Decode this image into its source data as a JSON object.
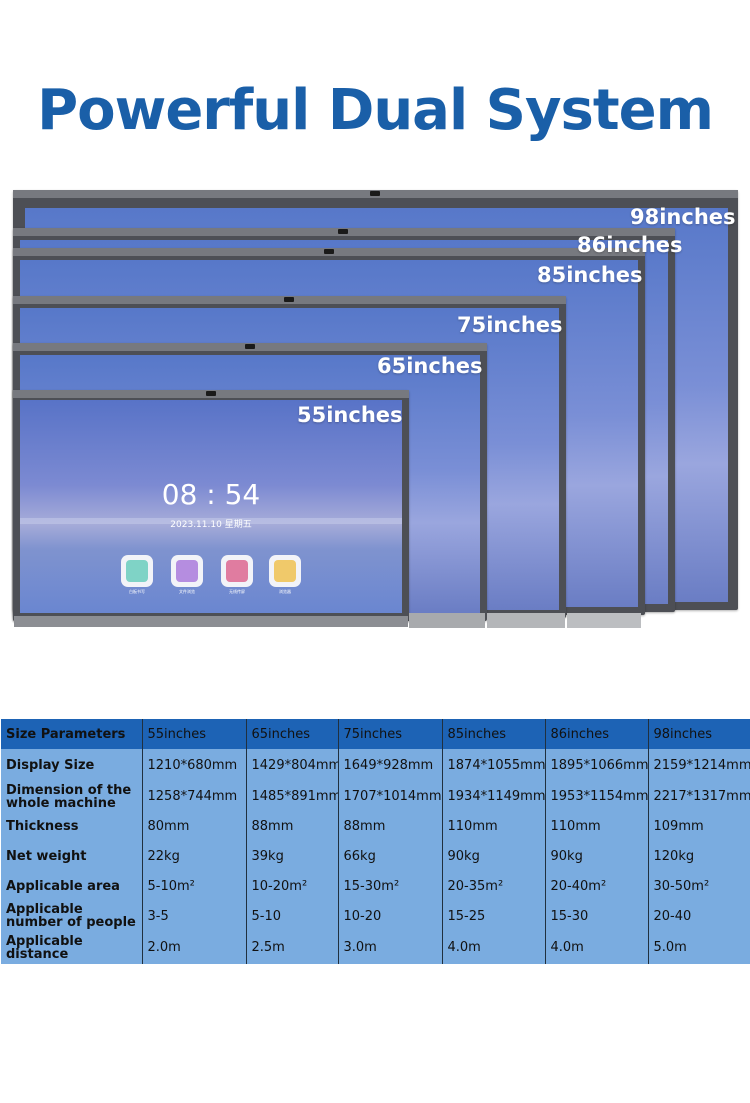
{
  "headline": "Powerful Dual System",
  "sizes": [
    "98inches",
    "86inches",
    "85inches",
    "75inches",
    "65inches",
    "55inches"
  ],
  "screen": {
    "time": "08 : 54",
    "date": "2023.11.10  星期五",
    "apps": [
      {
        "name": "whiteboard-app-icon",
        "caption": "白板书写",
        "color": "#7fd3c6"
      },
      {
        "name": "file-browser-app-icon",
        "caption": "文件浏览",
        "color": "#b58de0"
      },
      {
        "name": "wireless-screen-app-icon",
        "caption": "无线传屏",
        "color": "#e07ca0"
      },
      {
        "name": "browser-app-icon",
        "caption": "浏览器",
        "color": "#f0c96a"
      }
    ]
  },
  "table": {
    "header_label": "Size Parameters",
    "columns": [
      "55inches",
      "65inches",
      "75inches",
      "85inches",
      "86inches",
      "98inches"
    ],
    "rows": [
      {
        "label": "Display Size",
        "values": [
          "1210*680mm",
          "1429*804mm",
          "1649*928mm",
          "1874*1055mm",
          "1895*1066mm",
          "2159*1214mm"
        ]
      },
      {
        "label": "Dimension of the whole machine",
        "values": [
          "1258*744mm",
          "1485*891mm",
          "1707*1014mm",
          "1934*1149mm",
          "1953*1154mm",
          "2217*1317mm"
        ]
      },
      {
        "label": "Thickness",
        "values": [
          "80mm",
          "88mm",
          "88mm",
          "110mm",
          "110mm",
          "109mm"
        ]
      },
      {
        "label": "Net weight",
        "values": [
          "22kg",
          "39kg",
          "66kg",
          "90kg",
          "90kg",
          "120kg"
        ]
      },
      {
        "label": "Applicable area",
        "values": [
          "5-10m²",
          "10-20m²",
          "15-30m²",
          "20-35m²",
          "20-40m²",
          "30-50m²"
        ]
      },
      {
        "label": "Applicable number of people",
        "values": [
          "3-5",
          "5-10",
          "10-20",
          "15-25",
          "15-30",
          "20-40"
        ]
      },
      {
        "label": "Applicable distance",
        "values": [
          "2.0m",
          "2.5m",
          "3.0m",
          "4.0m",
          "4.0m",
          "5.0m"
        ]
      }
    ]
  }
}
